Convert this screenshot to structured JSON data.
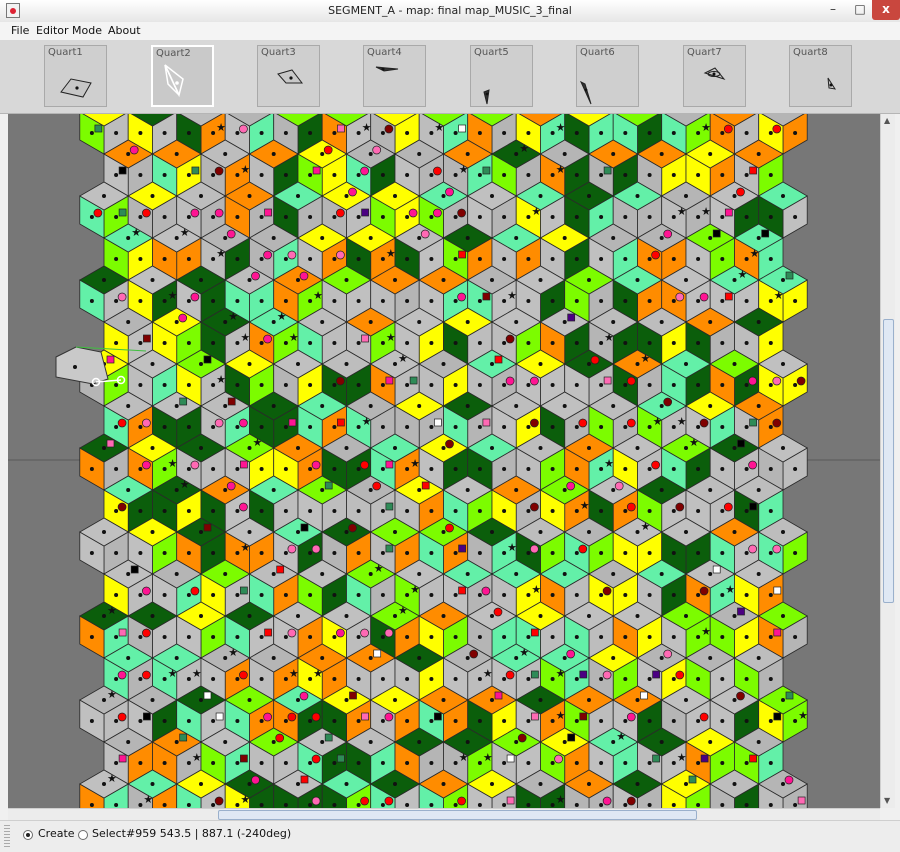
{
  "window": {
    "title": "SEGMENT_A - map: final map_MUSIC_3_final",
    "minimize_glyph": "–",
    "maximize_glyph": "□",
    "close_glyph": "x"
  },
  "menu": [
    "File",
    "Editor",
    "Mode",
    "About"
  ],
  "toolbar": {
    "quarts": [
      {
        "label": "Quart1",
        "icon": "parallelogram-shape-icon"
      },
      {
        "label": "Quart2",
        "icon": "kite-shape-icon"
      },
      {
        "label": "Quart3",
        "icon": "arrow-shape-icon"
      },
      {
        "label": "Quart4",
        "icon": "thin-dart-icon"
      },
      {
        "label": "Quart5",
        "icon": "spike-shape-icon"
      },
      {
        "label": "Quart6",
        "icon": "needle-shape-icon"
      },
      {
        "label": "Quart7",
        "icon": "eye-shape-icon"
      },
      {
        "label": "Quart8",
        "icon": "small-dart-icon"
      }
    ],
    "selected_index": 1
  },
  "map": {
    "palette": [
      "#bdbdbd",
      "#ff8c00",
      "#7cfc00",
      "#63f0a8",
      "#ffff00",
      "#0b5e0b",
      "#c0c0c0",
      "#b5b5b5"
    ],
    "markers": [
      "#000000",
      "#ff1493",
      "#800000",
      "#ff69b4",
      "#ff0000",
      "#2e8b57",
      "#4b0082",
      "#ffffff"
    ]
  },
  "status": {
    "mode_create": "Create",
    "mode_select": "Select",
    "readout": "#959 543.5 | 887.1 (-240deg)"
  }
}
